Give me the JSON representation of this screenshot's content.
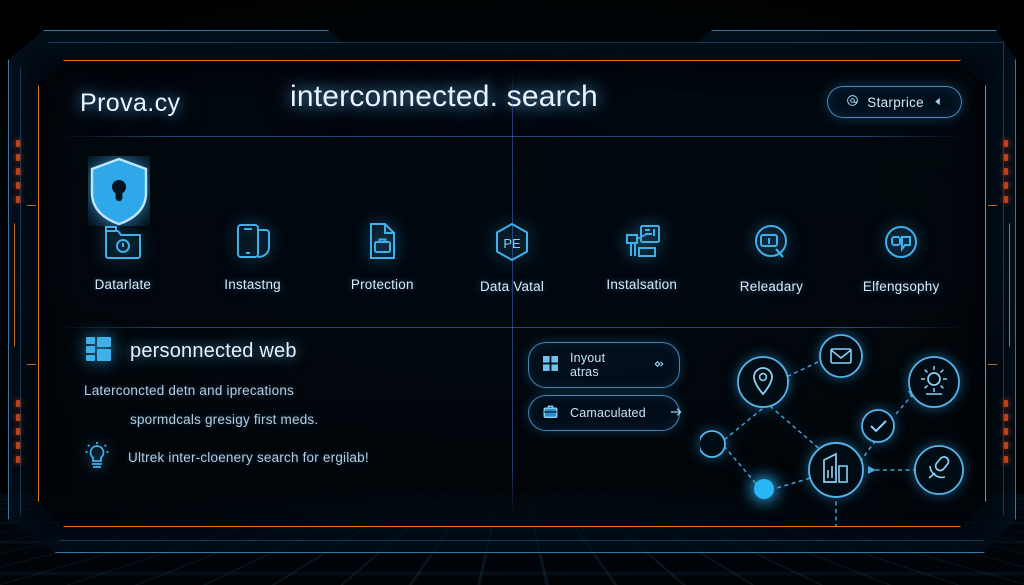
{
  "header": {
    "brand": "Prova.cy",
    "title": "interconnected. search",
    "pill": {
      "label": "Starprice",
      "left_icon": "at-circle-icon",
      "right_icon": "play-left-icon"
    }
  },
  "hero": {
    "icon": "shield-lock-icon"
  },
  "icon_row": [
    {
      "label": "Datarlate",
      "icon": "folder-clock-icon"
    },
    {
      "label": "Instastng",
      "icon": "mobile-document-icon"
    },
    {
      "label": "Protection",
      "icon": "document-briefcase-icon"
    },
    {
      "label": "Data Vatal",
      "icon": "pe-hexagon-icon"
    },
    {
      "label": "Instalsation",
      "icon": "data-transfer-icon"
    },
    {
      "label": "Releadary",
      "icon": "battery-search-icon"
    },
    {
      "label": "Elfengsophy",
      "icon": "quote-circle-icon"
    }
  ],
  "lower": {
    "heading": "personnected web",
    "heading_icon": "stacked-cards-icon",
    "lines": [
      {
        "text": "Laterconcted detn and iprecations",
        "icon": ""
      },
      {
        "text": "spormdcals gresigy first meds.",
        "icon": ""
      },
      {
        "text": "Ultrek inter-cloenery search for ergilab!",
        "icon": "lightbulb-icon"
      }
    ],
    "actions": [
      {
        "label": "Inyout atras",
        "left_icon": "grid-windows-icon",
        "right_icon": "diamond-chevron-icon"
      },
      {
        "label": "Camaculated",
        "left_icon": "briefcase-icon",
        "right_icon": "arrow-right-icon"
      }
    ]
  },
  "network": {
    "nodes": [
      {
        "name": "mail-node",
        "icon": "envelope-icon"
      },
      {
        "name": "location-node",
        "icon": "map-pin-icon"
      },
      {
        "name": "settings-node",
        "icon": "gear-people-icon"
      },
      {
        "name": "check-node",
        "icon": "check-circle-icon"
      },
      {
        "name": "chart-node",
        "icon": "bar-chart-icon"
      },
      {
        "name": "mic-node",
        "icon": "microphone-icon"
      },
      {
        "name": "empty-node",
        "icon": "circle-outline-icon"
      },
      {
        "name": "dot-node",
        "icon": "filled-dot-icon"
      }
    ]
  },
  "colors": {
    "accent_cyan": "#3fb0e8",
    "accent_orange": "#e8761c",
    "frame_blue": "#4696cd",
    "text_light": "#e9f4ff",
    "text_muted": "#b8cde0",
    "background": "#000306"
  }
}
